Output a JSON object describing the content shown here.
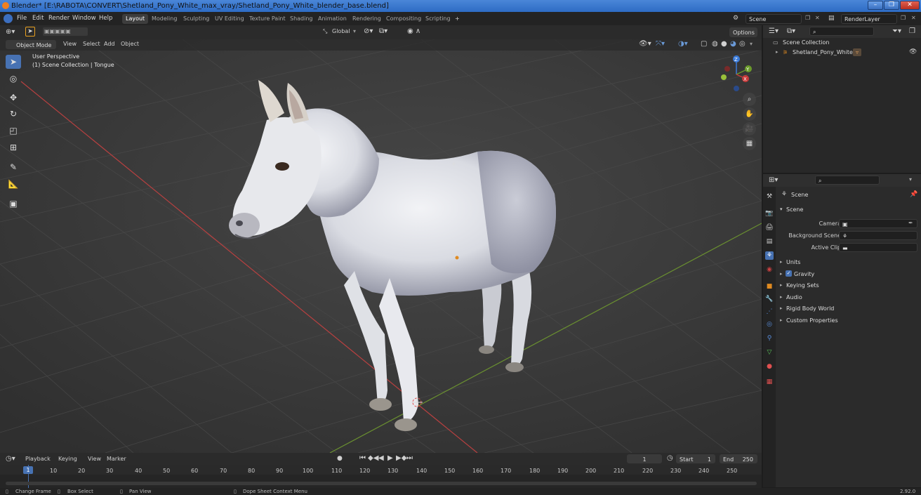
{
  "window": {
    "title": "Blender* [E:\\RABOTA\\CONVERT\\Shetland_Pony_White_max_vray/Shetland_Pony_White_blender_base.blend]",
    "buttons": [
      "–",
      "❐",
      "✕"
    ]
  },
  "menubar": {
    "menus": [
      "File",
      "Edit",
      "Render",
      "Window",
      "Help"
    ],
    "workspaces": [
      "Layout",
      "Modeling",
      "Sculpting",
      "UV Editing",
      "Texture Paint",
      "Shading",
      "Animation",
      "Rendering",
      "Compositing",
      "Scripting"
    ],
    "active_workspace": "Layout",
    "add_tab": "+",
    "scene_name": "Scene",
    "view_layer": "RenderLayer"
  },
  "viewport_header": {
    "mode": "Object Mode",
    "menus": [
      "View",
      "Select",
      "Add",
      "Object"
    ],
    "orientation": "Global",
    "options_label": "Options"
  },
  "viewport": {
    "perspective_label": "User Perspective",
    "collection_label": "(1) Scene Collection | Tongue",
    "axis_labels": {
      "z": "Z",
      "y": "Y",
      "x": "X"
    }
  },
  "outliner": {
    "root": "Scene Collection",
    "items": [
      {
        "label": "Shetland_Pony_White"
      }
    ]
  },
  "properties": {
    "context": "Scene",
    "section_title": "Scene",
    "fields": [
      {
        "label": "Camera",
        "value": ""
      },
      {
        "label": "Background Scene",
        "value": ""
      },
      {
        "label": "Active Clip",
        "value": ""
      }
    ],
    "panels": [
      "Units",
      "Gravity",
      "Keying Sets",
      "Audio",
      "Rigid Body World",
      "Custom Properties"
    ],
    "gravity_checked": true
  },
  "timeline": {
    "menus": [
      "Playback",
      "Keying",
      "View",
      "Marker"
    ],
    "current_frame": "1",
    "start_label": "Start",
    "start_value": "1",
    "end_label": "End",
    "end_value": "250",
    "ticks": [
      "1",
      "10",
      "20",
      "30",
      "40",
      "50",
      "60",
      "70",
      "80",
      "90",
      "100",
      "110",
      "120",
      "130",
      "140",
      "150",
      "160",
      "170",
      "180",
      "190",
      "200",
      "210",
      "220",
      "230",
      "240",
      "250"
    ]
  },
  "statusbar": {
    "items": [
      "Change Frame",
      "Box Select",
      "Pan View",
      "Dope Sheet Context Menu"
    ],
    "version": "2.92.0"
  },
  "colors": {
    "accent": "#4772b3",
    "x_axis": "#c83a3a",
    "y_axis": "#6a9a2a",
    "z_axis": "#3a7ad8"
  }
}
